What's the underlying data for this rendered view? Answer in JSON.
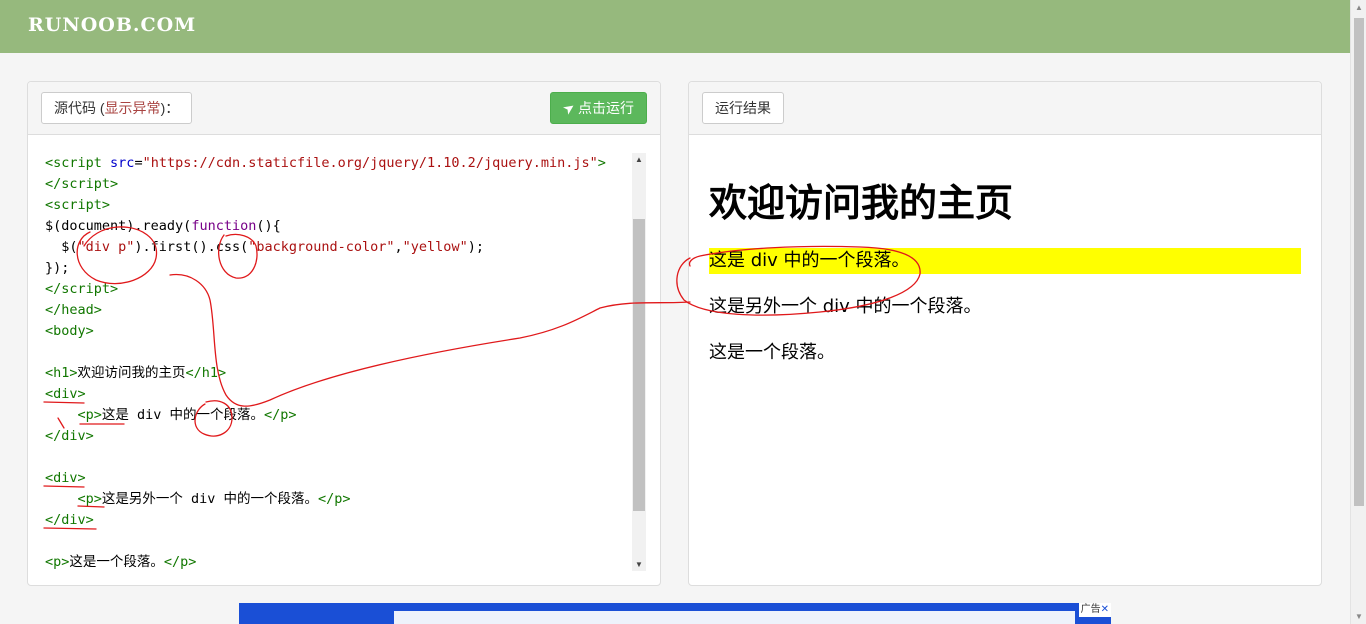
{
  "header": {
    "logo": "RUNOOB.COM"
  },
  "left_panel": {
    "source_label": "源代码 (",
    "error_label": "显示异常",
    "source_label_end": ")：",
    "run_label": "点击运行",
    "run_icon": "paper-plane-icon"
  },
  "right_panel": {
    "result_label": "运行结果",
    "heading": "欢迎访问我的主页",
    "paragraphs": [
      "这是 div 中的一个段落。",
      "这是另外一个 div 中的一个段落。",
      "这是一个段落。"
    ]
  },
  "ad": {
    "badge": "广告",
    "close": "✕"
  },
  "colors": {
    "header_bg": "#96b97d",
    "run_btn": "#5cb85c",
    "highlight": "#ffff00",
    "scribble": "#e0191b"
  }
}
